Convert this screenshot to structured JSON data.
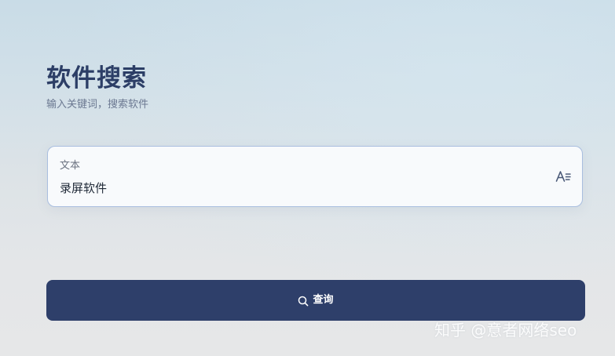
{
  "page": {
    "title": "软件搜索",
    "subtitle": "输入关键词，搜索软件"
  },
  "search_field": {
    "label": "文本",
    "value": "录屏软件",
    "icon": "text-format-icon"
  },
  "query_button": {
    "label": "查询",
    "icon": "search-icon"
  },
  "watermark": {
    "text": "知乎 @意者网络seo"
  },
  "colors": {
    "accent": "#2e3f6a",
    "title": "#2c3e66",
    "field_border": "#a9bedf"
  }
}
